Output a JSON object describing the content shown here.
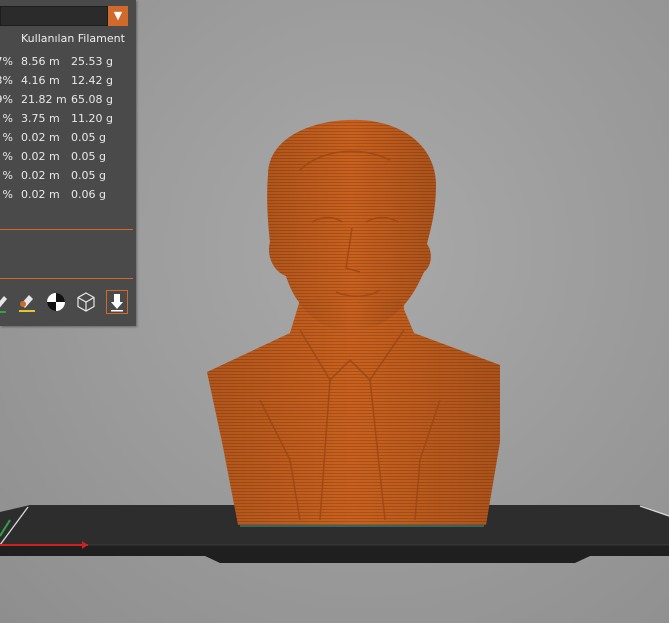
{
  "panel": {
    "column_header": "Kullanılan Filament",
    "rows": [
      {
        "percent": "7%",
        "length": "8.56 m",
        "weight": "25.53 g"
      },
      {
        "percent": "3%",
        "length": "4.16 m",
        "weight": "12.42 g"
      },
      {
        "percent": "9%",
        "length": "21.82 m",
        "weight": "65.08 g"
      },
      {
        "percent": "%",
        "length": "3.75 m",
        "weight": "11.20 g"
      },
      {
        "percent": "%",
        "length": "0.02 m",
        "weight": "0.05 g"
      },
      {
        "percent": "%",
        "length": "0.02 m",
        "weight": "0.05 g"
      },
      {
        "percent": "%",
        "length": "0.02 m",
        "weight": "0.05 g"
      },
      {
        "percent": "%",
        "length": "0.02 m",
        "weight": "0.06 g"
      }
    ],
    "dropdown_icon": "triangle-down-icon",
    "toolbar_icons": [
      "edit-icon",
      "paint-brush-icon",
      "center-of-mass-icon",
      "wireframe-cube-icon",
      "download-icon"
    ]
  },
  "colors": {
    "accent": "#d0692a",
    "model": "#c8611f",
    "panel": "#4a4a4a",
    "bed": "#2a2a2a"
  }
}
